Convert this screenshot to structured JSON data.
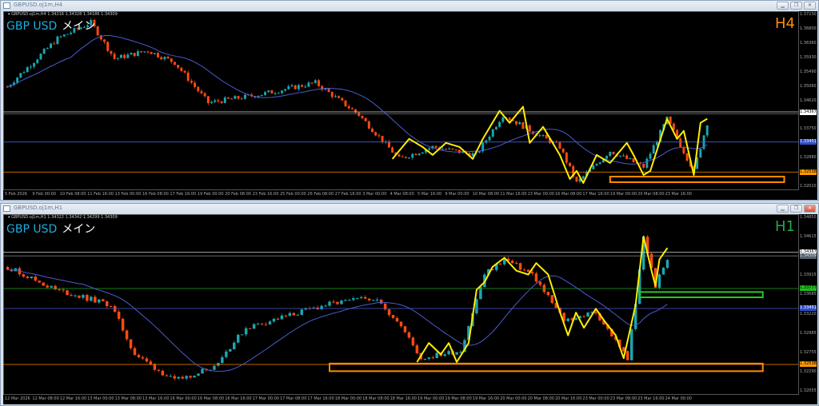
{
  "colors": {
    "bull": "#1aa6b0",
    "bear": "#ff4a10",
    "ma": "#4a5cd0",
    "zigzag": "#ffee00",
    "orange": "#ff8c00",
    "green": "#22cc22",
    "bid": "#dddddd",
    "ask": "#888888"
  },
  "windows": [
    {
      "title": "GBPUSD.oj1m,H4",
      "info": "▾ GBPUSD.oj1m,H4  1.34216 1.34328 1.34186 1.34309",
      "symbol": "GBP USD",
      "label": "メイン",
      "timeframe": "H4",
      "tf_color": "#ff8c00",
      "buttons": [
        "minimize",
        "restore",
        "close"
      ],
      "price_min": 1.3201,
      "price_max": 1.3743,
      "bars": 235,
      "price_labels": [
        "1.37230",
        "1.36800",
        "1.36360",
        "1.35930",
        "1.35490",
        "1.35060",
        "1.34620",
        "1.34190",
        "1.33750",
        "1.33320",
        "1.32880",
        "1.32450",
        "1.32010"
      ],
      "tags": [
        {
          "text": "1.34367",
          "price": 1.34367,
          "bg": "#ffffff",
          "fg": "#000"
        },
        {
          "text": "1.33451",
          "price": 1.33451,
          "bg": "#3050c8",
          "fg": "#fff"
        },
        {
          "text": "1.32538",
          "price": 1.32538,
          "bg": "#ff9900",
          "fg": "#000"
        }
      ],
      "hlines": [
        {
          "price": 1.34367,
          "color": "#dddddd"
        },
        {
          "price": 1.34309,
          "color": "#777777"
        },
        {
          "price": 1.33451,
          "color": "#4a5cd0"
        },
        {
          "price": 1.32538,
          "color": "#ff8c00"
        }
      ],
      "time_labels": [
        "5 Feb 2026",
        "9 Feb 00:00",
        "10 Feb 08:00",
        "11 Feb 16:00",
        "13 Feb 00:00",
        "16 Feb 08:00",
        "17 Feb 16:00",
        "19 Feb 00:00",
        "20 Feb 08:00",
        "23 Feb 16:00",
        "25 Feb 00:00",
        "26 Feb 08:00",
        "27 Feb 16:00",
        "3 Mar 00:00",
        "4 Mar 08:00",
        "5 Mar 16:00",
        "9 Mar 00:00",
        "10 Mar 08:00",
        "11 Mar 16:00",
        "13 Mar 00:00",
        "16 Mar 08:00",
        "17 Mar 16:00",
        "19 Mar 00:00",
        "20 Mar 08:00",
        "23 Mar 16:00"
      ],
      "price_path": [
        [
          0,
          1.35133
        ],
        [
          15,
          1.36597
        ],
        [
          25,
          1.37085
        ],
        [
          32,
          1.35987
        ],
        [
          42,
          1.36231
        ],
        [
          50,
          1.35865
        ],
        [
          60,
          1.34645
        ],
        [
          75,
          1.34889
        ],
        [
          92,
          1.35255
        ],
        [
          105,
          1.34279
        ],
        [
          117,
          1.32937
        ],
        [
          127,
          1.33303
        ],
        [
          140,
          1.33059
        ],
        [
          148,
          1.34279
        ],
        [
          165,
          1.33303
        ],
        [
          170,
          1.32205
        ],
        [
          180,
          1.33181
        ],
        [
          190,
          1.32693
        ],
        [
          197,
          1.34157
        ],
        [
          205,
          1.32571
        ],
        [
          209,
          1.34035
        ]
      ],
      "zigzag": [
        [
          115,
          1.32937
        ],
        [
          120,
          1.33547
        ],
        [
          124,
          1.33303
        ],
        [
          127,
          1.33059
        ],
        [
          131,
          1.33425
        ],
        [
          135,
          1.33303
        ],
        [
          139,
          1.32937
        ],
        [
          142,
          1.33547
        ],
        [
          147,
          1.34401
        ],
        [
          150,
          1.34035
        ],
        [
          154,
          1.34523
        ],
        [
          156,
          1.33425
        ],
        [
          160,
          1.33913
        ],
        [
          165,
          1.33059
        ],
        [
          168,
          1.32327
        ],
        [
          170,
          1.32571
        ],
        [
          172,
          1.32205
        ],
        [
          176,
          1.33059
        ],
        [
          180,
          1.32815
        ],
        [
          185,
          1.33425
        ],
        [
          187,
          1.33059
        ],
        [
          190,
          1.32449
        ],
        [
          192,
          1.32571
        ],
        [
          197,
          1.34157
        ],
        [
          200,
          1.33547
        ],
        [
          202,
          1.33791
        ],
        [
          205,
          1.32449
        ],
        [
          207,
          1.34035
        ],
        [
          209,
          1.34157
        ]
      ],
      "rects": [
        {
          "bars": [
            180,
            232
          ],
          "prices": [
            1.3223,
            1.324
          ],
          "color": "#ff8c00"
        }
      ]
    },
    {
      "title": "GBPUSD.oj1m,H1",
      "info": "▾ GBPUSD.oj1m,H1  1.34322 1.34342 1.34299 1.34309",
      "symbol": "GBP USD",
      "label": "メイン",
      "timeframe": "H1",
      "tf_color": "#22aa44",
      "buttons": [
        "minimize",
        "restore",
        "close"
      ],
      "price_min": 1.32055,
      "price_max": 1.3499,
      "bars": 198,
      "price_labels": [
        "1.34850",
        "1.34615",
        "1.34150",
        "1.33915",
        "1.33685",
        "1.33220",
        "1.32985",
        "1.32755",
        "1.32290",
        "1.32055"
      ],
      "tags": [
        {
          "text": "1.34367",
          "price": 1.34367,
          "bg": "#ffffff",
          "fg": "#000"
        },
        {
          "text": "1.34309",
          "price": 1.34309,
          "bg": "#556070",
          "fg": "#ddd"
        },
        {
          "text": "1.33777",
          "price": 1.33777,
          "bg": "#22bb22",
          "fg": "#000"
        },
        {
          "text": "1.33451",
          "price": 1.33451,
          "bg": "#3050c8",
          "fg": "#fff"
        },
        {
          "text": "1.32538",
          "price": 1.32538,
          "bg": "#ff9900",
          "fg": "#000"
        }
      ],
      "hlines": [
        {
          "price": 1.34367,
          "color": "#dddddd"
        },
        {
          "price": 1.34309,
          "color": "#777777"
        },
        {
          "price": 1.33777,
          "color": "#22aa22"
        },
        {
          "price": 1.33451,
          "color": "#4a5cd0"
        },
        {
          "price": 1.32538,
          "color": "#ff8c00"
        }
      ],
      "time_labels": [
        "12 Mar 2026",
        "12 Mar 08:00",
        "12 Mar 16:00",
        "13 Mar 00:00",
        "13 Mar 08:00",
        "13 Mar 16:00",
        "16 Mar 00:00",
        "16 Mar 08:00",
        "16 Mar 16:00",
        "17 Mar 00:00",
        "17 Mar 08:00",
        "17 Mar 16:00",
        "18 Mar 00:00",
        "18 Mar 08:00",
        "18 Mar 16:00",
        "19 Mar 00:00",
        "19 Mar 08:00",
        "19 Mar 16:00",
        "20 Mar 00:00",
        "20 Mar 08:00",
        "20 Mar 16:00",
        "23 Mar 00:00",
        "23 Mar 08:00",
        "23 Mar 16:00",
        "24 Mar 00:00"
      ],
      "price_path": [
        [
          0,
          1.3413
        ],
        [
          12,
          1.33757
        ],
        [
          26,
          1.33509
        ],
        [
          32,
          1.32701
        ],
        [
          42,
          1.32267
        ],
        [
          52,
          1.32515
        ],
        [
          60,
          1.33136
        ],
        [
          80,
          1.33509
        ],
        [
          92,
          1.33633
        ],
        [
          98,
          1.3326
        ],
        [
          104,
          1.32639
        ],
        [
          114,
          1.32763
        ],
        [
          120,
          1.34005
        ],
        [
          125,
          1.34254
        ],
        [
          132,
          1.34005
        ],
        [
          140,
          1.3326
        ],
        [
          148,
          1.33384
        ],
        [
          156,
          1.32639
        ],
        [
          158,
          1.33509
        ],
        [
          160,
          1.34626
        ],
        [
          163,
          1.33819
        ],
        [
          166,
          1.34254
        ]
      ],
      "zigzag": [
        [
          103,
          1.32577
        ],
        [
          106,
          1.32888
        ],
        [
          109,
          1.32701
        ],
        [
          111,
          1.32888
        ],
        [
          113,
          1.32577
        ],
        [
          116,
          1.32888
        ],
        [
          118,
          1.33757
        ],
        [
          120,
          1.33881
        ],
        [
          122,
          1.3413
        ],
        [
          125,
          1.34279
        ],
        [
          128,
          1.34068
        ],
        [
          131,
          1.34005
        ],
        [
          133,
          1.34192
        ],
        [
          136,
          1.34005
        ],
        [
          139,
          1.33384
        ],
        [
          141,
          1.33012
        ],
        [
          143,
          1.33384
        ],
        [
          145,
          1.33136
        ],
        [
          148,
          1.33447
        ],
        [
          150,
          1.3326
        ],
        [
          153,
          1.33012
        ],
        [
          155,
          1.32639
        ],
        [
          158,
          1.33509
        ],
        [
          160,
          1.34626
        ],
        [
          162,
          1.34068
        ],
        [
          163,
          1.33819
        ],
        [
          164,
          1.34254
        ],
        [
          166,
          1.3444
        ]
      ],
      "rects": [
        {
          "bars": [
            81,
            190
          ],
          "prices": [
            1.32428,
            1.32552
          ],
          "color": "#ff8c00"
        },
        {
          "bars": [
            159,
            190
          ],
          "prices": [
            1.33633,
            1.3372
          ],
          "color": "#22cc22"
        }
      ]
    }
  ]
}
